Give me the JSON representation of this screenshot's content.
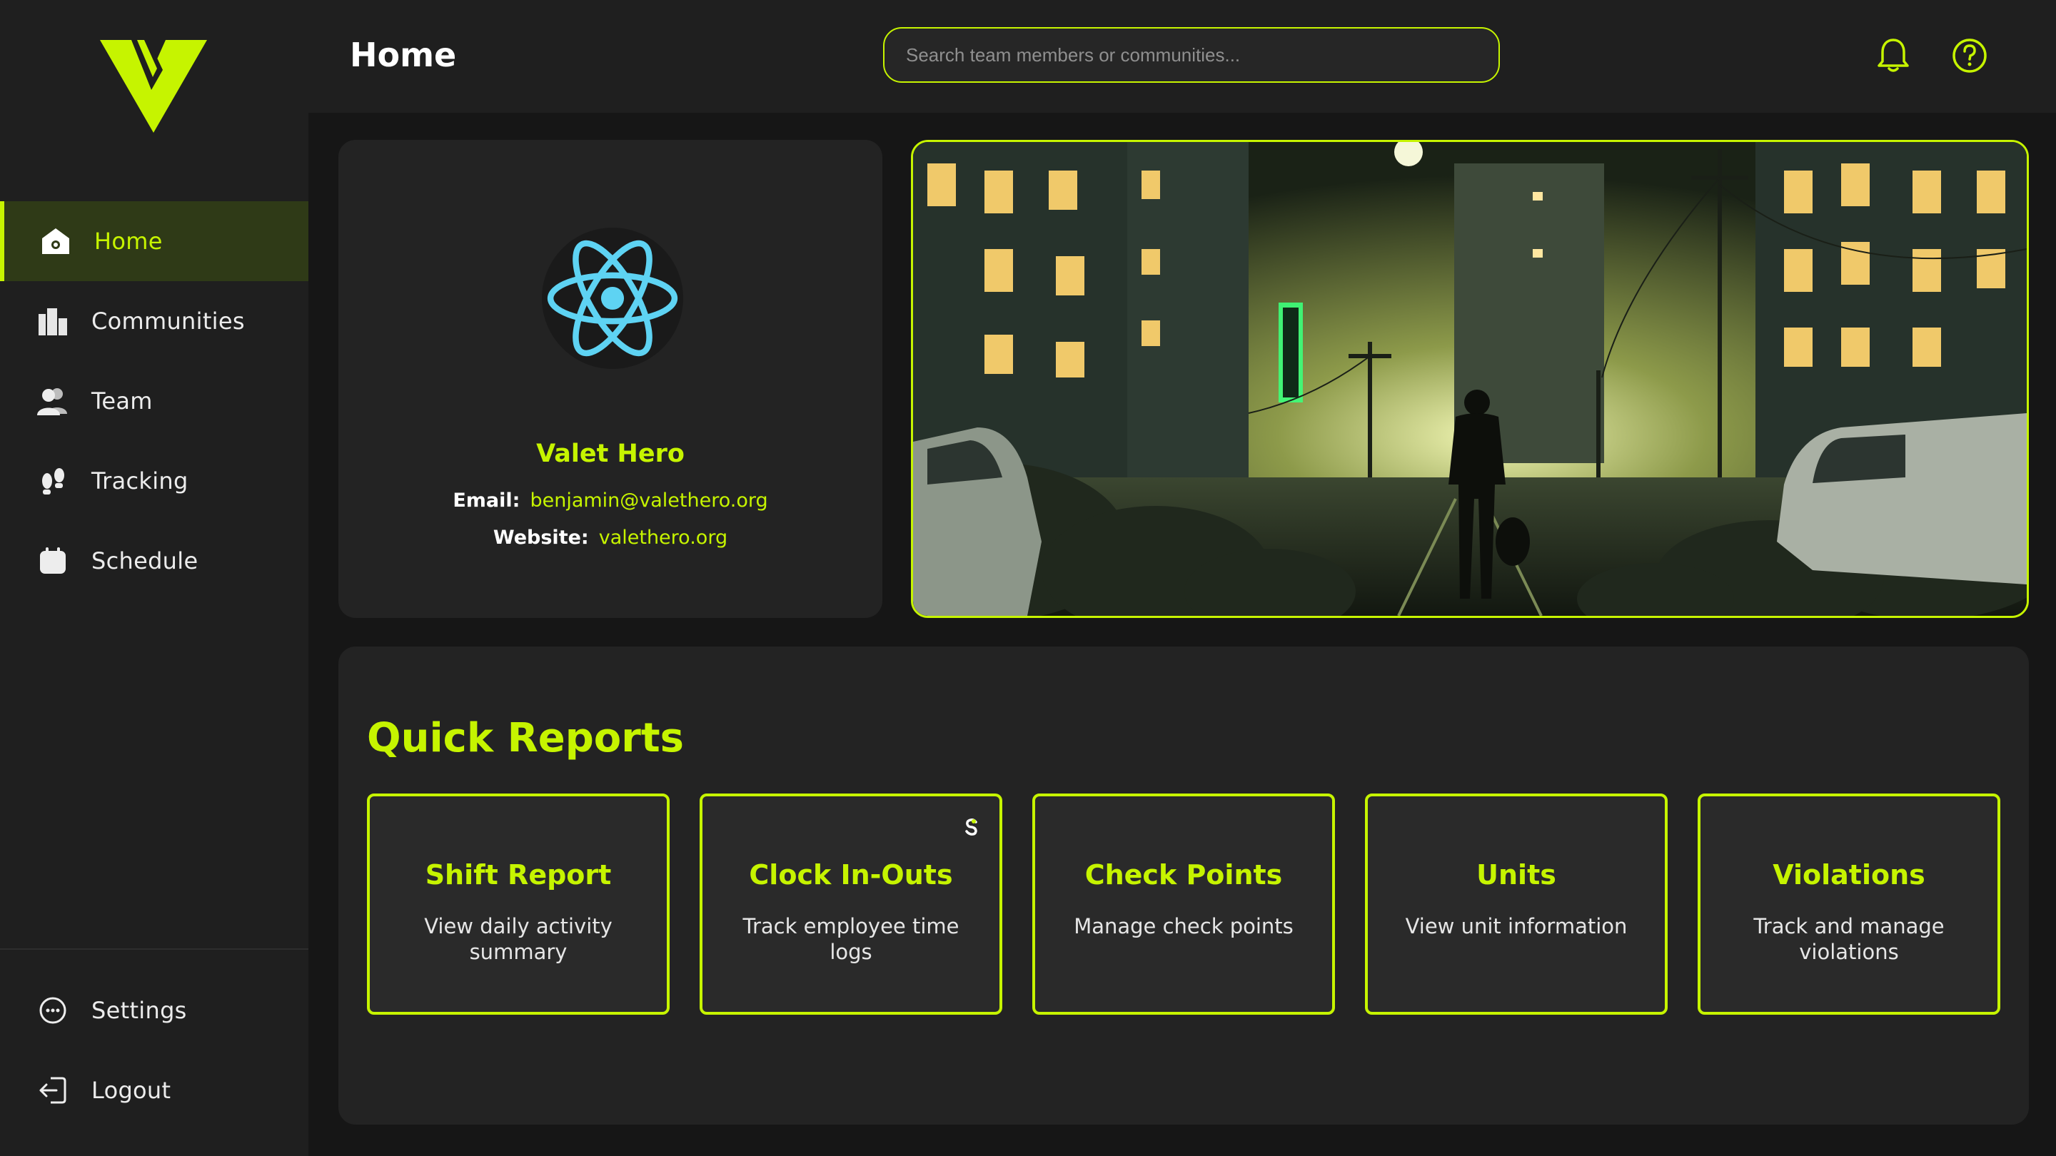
{
  "app": {
    "accent": "#c6f400",
    "logo_icon": "brand-logo"
  },
  "header": {
    "title": "Home",
    "search_placeholder": "Search team members or communities...",
    "notification_icon": "bell-icon",
    "help_icon": "help-icon"
  },
  "sidebar": {
    "items": [
      {
        "label": "Home",
        "icon": "home-icon",
        "active": true
      },
      {
        "label": "Communities",
        "icon": "buildings-icon"
      },
      {
        "label": "Team",
        "icon": "team-icon"
      },
      {
        "label": "Tracking",
        "icon": "footprints-icon"
      },
      {
        "label": "Schedule",
        "icon": "calendar-icon"
      }
    ],
    "bottom": [
      {
        "label": "Settings",
        "icon": "settings-icon"
      },
      {
        "label": "Logout",
        "icon": "logout-icon"
      }
    ]
  },
  "profile": {
    "name": "Valet Hero",
    "email_label": "Email:",
    "email": "benjamin@valethero.org",
    "website_label": "Website:",
    "website": "valethero.org",
    "avatar_icon": "react-logo-icon"
  },
  "hero": {
    "image": "night-city-street-illustration"
  },
  "quick_reports": {
    "title": "Quick Reports",
    "cards": [
      {
        "title": "Shift Report",
        "description": "View daily activity summary"
      },
      {
        "title": "Clock In-Outs",
        "description": "Track employee time logs"
      },
      {
        "title": "Check Points",
        "description": "Manage check points"
      },
      {
        "title": "Units",
        "description": "View unit information"
      },
      {
        "title": "Violations",
        "description": "Track and manage violations"
      }
    ]
  }
}
